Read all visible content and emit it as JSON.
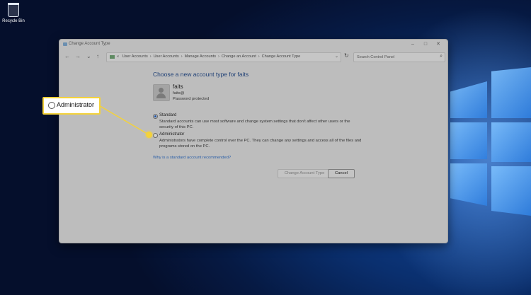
{
  "desktop": {
    "recycle_bin_label": "Recycle Bin"
  },
  "window": {
    "title": "Change Account Type",
    "controls": {
      "minimize": "–",
      "maximize": "□",
      "close": "✕"
    }
  },
  "nav": {
    "back": "←",
    "forward": "→",
    "dropdown": "⌄",
    "up": "↑",
    "breadcrumb": [
      "« ",
      "User Accounts",
      "›",
      "User Accounts",
      "›",
      "Manage Accounts",
      "›",
      "Change an Account",
      "›",
      "Change Account Type"
    ],
    "address_dropdown": "⌄",
    "refresh": "↻",
    "search_placeholder": "Search Control Panel",
    "search_icon": "⌕"
  },
  "main": {
    "heading": "Choose a new account type for faits",
    "user": {
      "name": "faits",
      "email": "faits@",
      "status": "Password protected"
    },
    "options": [
      {
        "label": "Standard",
        "description": "Standard accounts can use most software and change system settings that don't affect other users or the security of this PC.",
        "selected": true
      },
      {
        "label": "Administrator",
        "description": "Administrators have complete control over the PC. They can change any settings and access all of the files and programs stored on the PC.",
        "selected": false
      }
    ],
    "help_link": "Why is a standard account recommended?",
    "buttons": {
      "change": "Change Account Type",
      "cancel": "Cancel"
    }
  },
  "callout": {
    "label": "Administrator",
    "accent_color": "#f4d23a"
  }
}
